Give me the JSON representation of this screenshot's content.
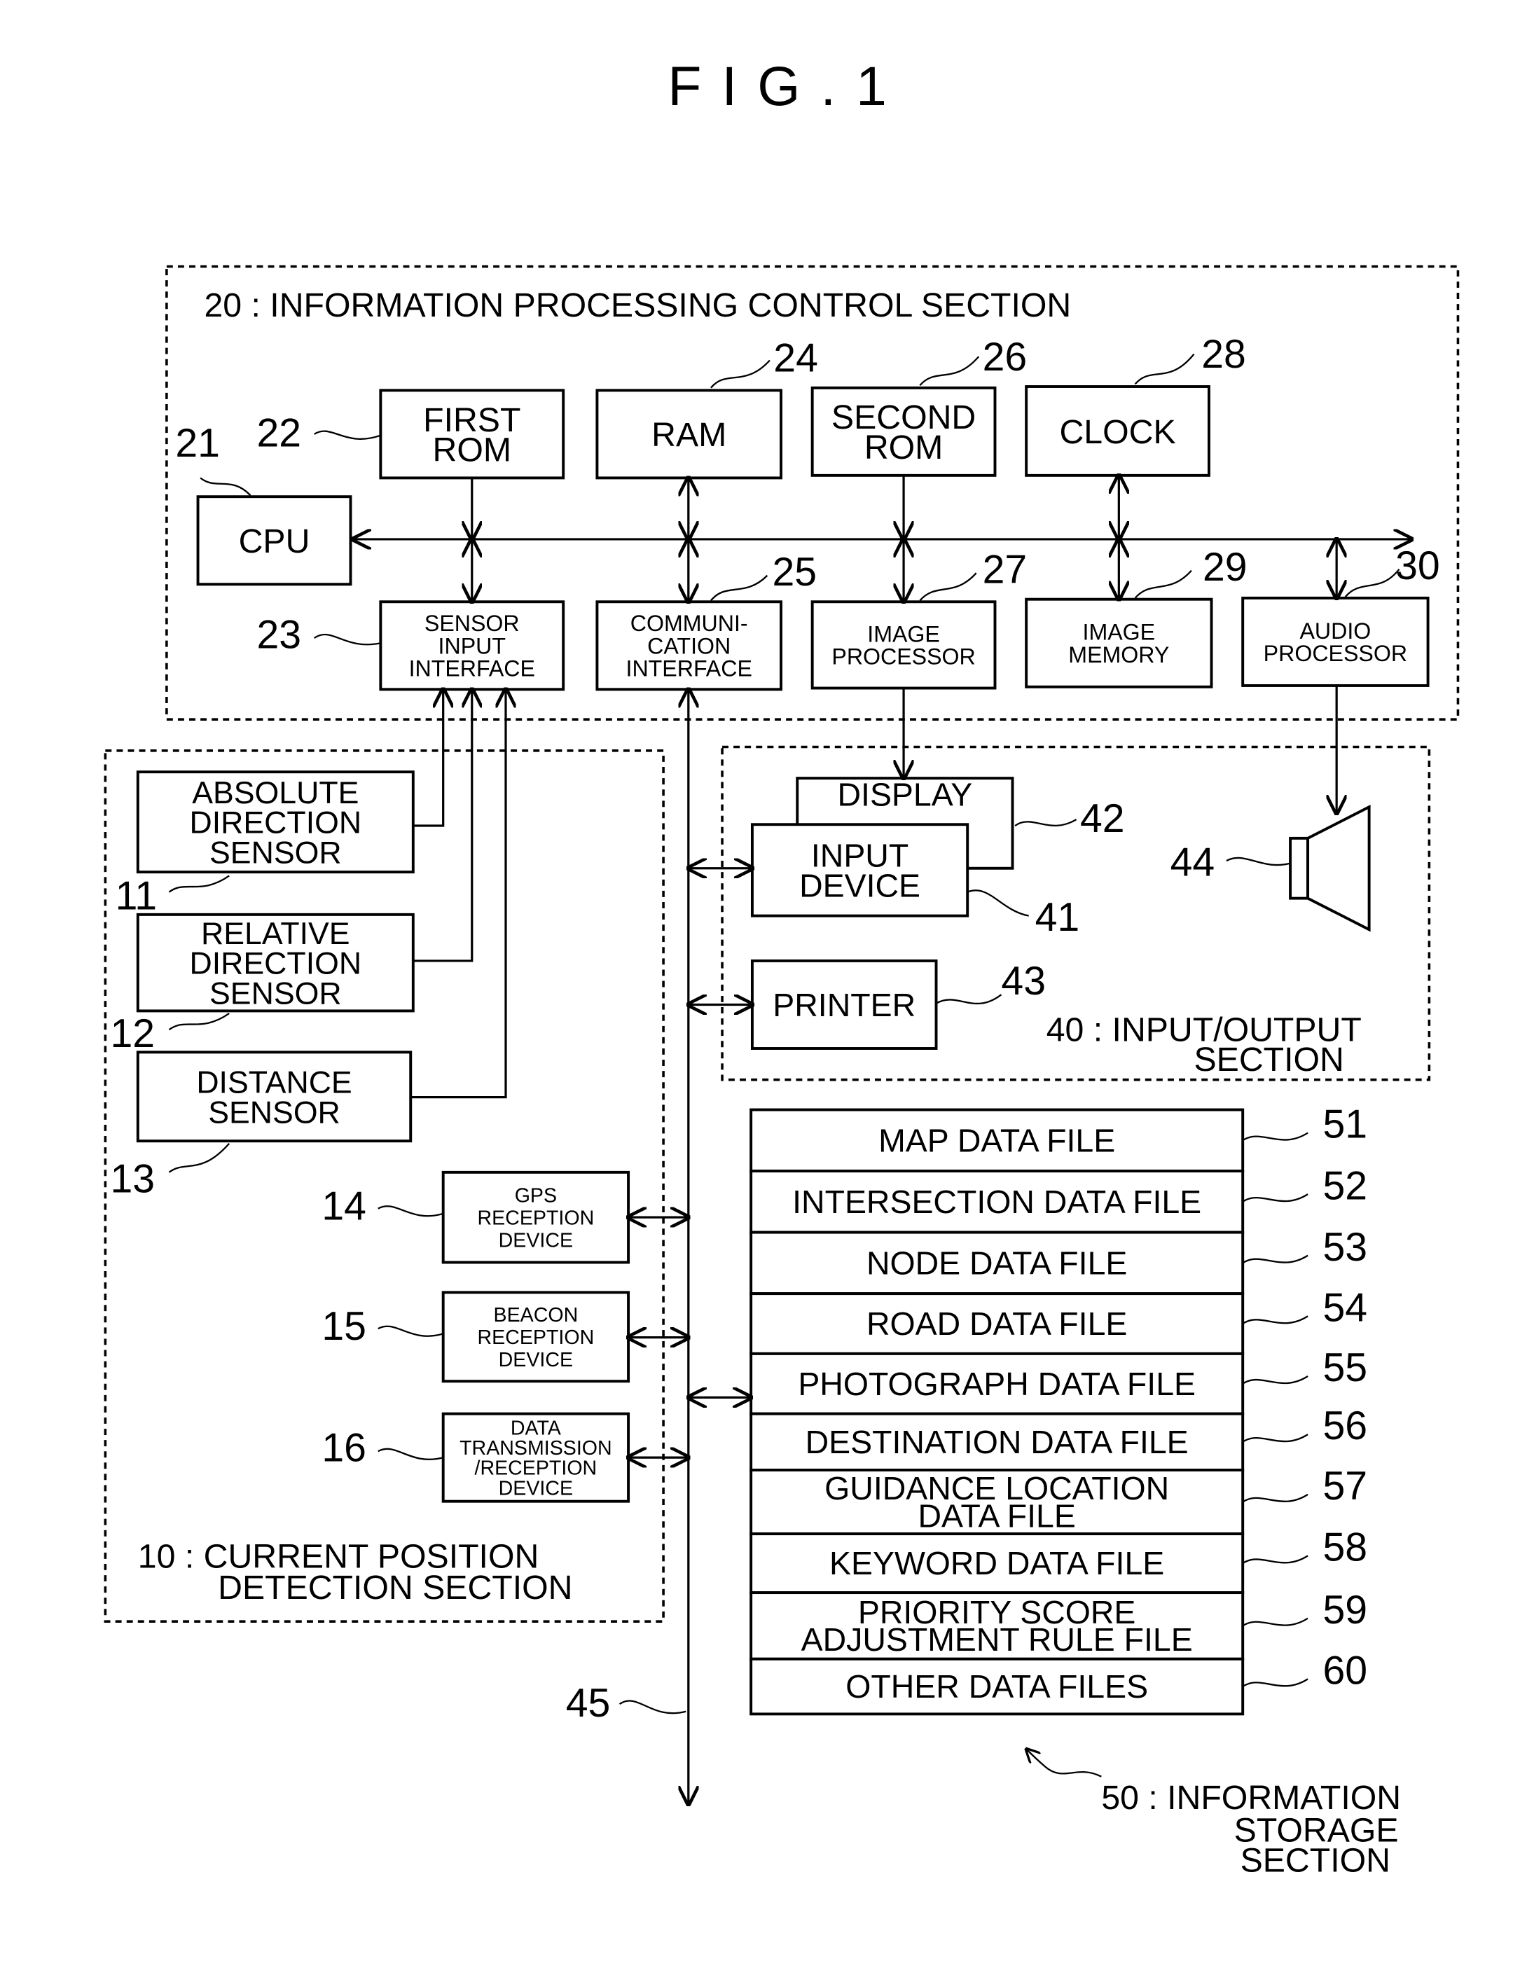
{
  "figure": {
    "title": "F I G . 1"
  },
  "sections": {
    "s20": "20 : INFORMATION PROCESSING CONTROL SECTION",
    "s10_line1": "10 : CURRENT POSITION",
    "s10_line2": "DETECTION SECTION",
    "s40_line1": "40 : INPUT/OUTPUT",
    "s40_line2": "SECTION",
    "s50_line1": "50 : INFORMATION",
    "s50_line2": "STORAGE",
    "s50_line3": "SECTION"
  },
  "blocks": {
    "cpu": {
      "num": "21",
      "lines": [
        "CPU"
      ]
    },
    "first_rom": {
      "num": "22",
      "lines": [
        "FIRST",
        "ROM"
      ]
    },
    "sensor_if": {
      "num": "23",
      "lines": [
        "SENSOR",
        "INPUT",
        "INTERFACE"
      ]
    },
    "ram": {
      "num": "24",
      "lines": [
        "RAM"
      ]
    },
    "comm_if": {
      "num": "25",
      "lines": [
        "COMMUNI-",
        "CATION",
        "INTERFACE"
      ]
    },
    "second_rom": {
      "num": "26",
      "lines": [
        "SECOND",
        "ROM"
      ]
    },
    "image_proc": {
      "num": "27",
      "lines": [
        "IMAGE",
        "PROCESSOR"
      ]
    },
    "clock": {
      "num": "28",
      "lines": [
        "CLOCK"
      ]
    },
    "image_mem": {
      "num": "29",
      "lines": [
        "IMAGE",
        "MEMORY"
      ]
    },
    "audio_proc": {
      "num": "30",
      "lines": [
        "AUDIO",
        "PROCESSOR"
      ]
    },
    "abs_sensor": {
      "num": "11",
      "lines": [
        "ABSOLUTE",
        "DIRECTION",
        "SENSOR"
      ]
    },
    "rel_sensor": {
      "num": "12",
      "lines": [
        "RELATIVE",
        "DIRECTION",
        "SENSOR"
      ]
    },
    "dist_sensor": {
      "num": "13",
      "lines": [
        "DISTANCE",
        "SENSOR"
      ]
    },
    "gps": {
      "num": "14",
      "lines": [
        "GPS",
        "RECEPTION",
        "DEVICE"
      ]
    },
    "beacon": {
      "num": "15",
      "lines": [
        "BEACON",
        "RECEPTION",
        "DEVICE"
      ]
    },
    "data_trx": {
      "num": "16",
      "lines": [
        "DATA",
        "TRANSMISSION",
        "/RECEPTION",
        "DEVICE"
      ]
    },
    "input_device": {
      "num": "41",
      "lines": [
        "INPUT",
        "DEVICE"
      ]
    },
    "display": {
      "num": "42",
      "lines": [
        "DISPLAY"
      ]
    },
    "printer": {
      "num": "43",
      "lines": [
        "PRINTER"
      ]
    },
    "speaker": {
      "num": "44"
    },
    "bus": {
      "num": "45"
    }
  },
  "files": [
    {
      "num": "51",
      "lines": [
        "MAP DATA FILE"
      ]
    },
    {
      "num": "52",
      "lines": [
        "INTERSECTION DATA FILE"
      ]
    },
    {
      "num": "53",
      "lines": [
        "NODE DATA FILE"
      ]
    },
    {
      "num": "54",
      "lines": [
        "ROAD DATA FILE"
      ]
    },
    {
      "num": "55",
      "lines": [
        "PHOTOGRAPH DATA FILE"
      ]
    },
    {
      "num": "56",
      "lines": [
        "DESTINATION DATA FILE"
      ]
    },
    {
      "num": "57",
      "lines": [
        "GUIDANCE LOCATION",
        "DATA FILE"
      ]
    },
    {
      "num": "58",
      "lines": [
        "KEYWORD DATA FILE"
      ]
    },
    {
      "num": "59",
      "lines": [
        "PRIORITY SCORE",
        "ADJUSTMENT RULE FILE"
      ]
    },
    {
      "num": "60",
      "lines": [
        "OTHER DATA FILES"
      ]
    }
  ]
}
